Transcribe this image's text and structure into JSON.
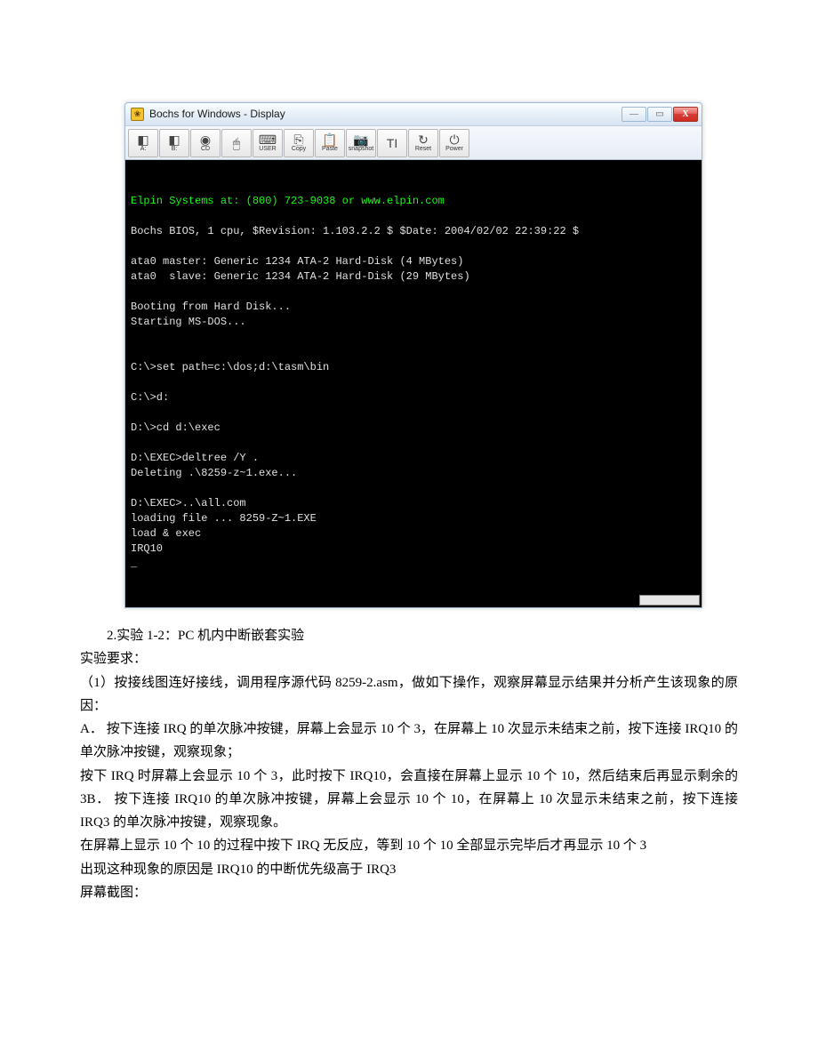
{
  "window": {
    "title": "Bochs for Windows - Display",
    "app_icon_glyph": "❀"
  },
  "win_buttons": {
    "min_glyph": "—",
    "max_glyph": "▭",
    "close_glyph": "X"
  },
  "toolbar": [
    {
      "name": "floppy-a-button",
      "label": "A:",
      "glyph": "◧"
    },
    {
      "name": "floppy-b-button",
      "label": "B:",
      "glyph": "◧"
    },
    {
      "name": "cdrom-button",
      "label": "CD",
      "glyph": "◉"
    },
    {
      "name": "mouse-button",
      "label": "",
      "glyph": "🖱"
    },
    {
      "name": "user-button",
      "label": "USER",
      "glyph": "⌨"
    },
    {
      "name": "copy-button",
      "label": "Copy",
      "glyph": "⎘"
    },
    {
      "name": "paste-button",
      "label": "Paste",
      "glyph": "📋"
    },
    {
      "name": "snapshot-button",
      "label": "snapshot",
      "glyph": "📷"
    },
    {
      "name": "config-button",
      "label": "",
      "glyph": "TI"
    },
    {
      "name": "reset-button",
      "label": "Reset",
      "glyph": "↻"
    },
    {
      "name": "power-button",
      "label": "Power",
      "glyph": "⏻"
    }
  ],
  "console": {
    "line_green": "Elpin Systems at: (800) 723-9038 or www.elpin.com",
    "lines": [
      "",
      "Bochs BIOS, 1 cpu, $Revision: 1.103.2.2 $ $Date: 2004/02/02 22:39:22 $",
      "",
      "ata0 master: Generic 1234 ATA-2 Hard-Disk (4 MBytes)",
      "ata0  slave: Generic 1234 ATA-2 Hard-Disk (29 MBytes)",
      "",
      "Booting from Hard Disk...",
      "Starting MS-DOS...",
      "",
      "",
      "C:\\>set path=c:\\dos;d:\\tasm\\bin",
      "",
      "C:\\>d:",
      "",
      "D:\\>cd d:\\exec",
      "",
      "D:\\EXEC>deltree /Y .",
      "Deleting .\\8259-z~1.exe...",
      "",
      "D:\\EXEC>..\\all.com",
      "loading file ... 8259-Z~1.EXE",
      "load & exec",
      "IRQ10",
      "_"
    ]
  },
  "doc": {
    "p1": "2.实验 1-2：PC 机内中断嵌套实验",
    "p2": "实验要求：",
    "p3": "（1）按接线图连好接线，调用程序源代码 8259-2.asm，做如下操作，观察屏幕显示结果并分析产生该现象的原因：",
    "p4": "A．  按下连接 IRQ 的单次脉冲按键，屏幕上会显示 10 个 3，在屏幕上 10 次显示未结束之前，按下连接 IRQ10 的单次脉冲按键，观察现象；",
    "p5": "按下 IRQ 时屏幕上会显示 10 个 3，此时按下 IRQ10，会直接在屏幕上显示 10 个 10，然后结束后再显示剩余的 3B．  按下连接 IRQ10 的单次脉冲按键，屏幕上会显示 10 个 10，在屏幕上 10 次显示未结束之前，按下连接 IRQ3 的单次脉冲按键，观察现象。",
    "p6": "在屏幕上显示 10 个 10 的过程中按下 IRQ 无反应，等到 10 个 10 全部显示完毕后才再显示 10 个 3",
    "p7": "出现这种现象的原因是 IRQ10 的中断优先级高于 IRQ3",
    "p8": "屏幕截图："
  }
}
